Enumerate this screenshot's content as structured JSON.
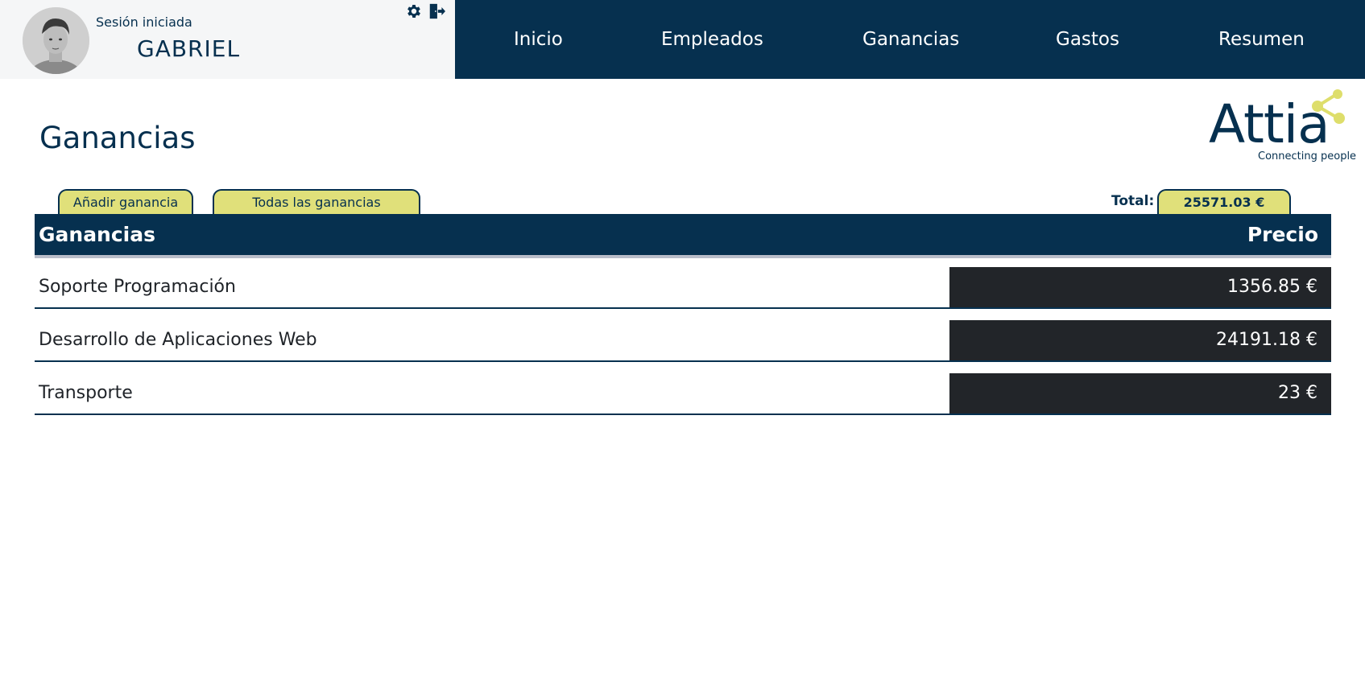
{
  "user": {
    "session_label": "Sesión iniciada",
    "name": "GABRIEL"
  },
  "icons": {
    "settings": "gear-icon",
    "logout": "logout-icon",
    "avatar": "user-photo"
  },
  "nav": {
    "items": [
      "Inicio",
      "Empleados",
      "Ganancias",
      "Gastos",
      "Resumen"
    ]
  },
  "page": {
    "title": "Ganancias"
  },
  "logo": {
    "word": "Attia",
    "tagline": "Connecting people"
  },
  "tabs": {
    "add": "Añadir ganancia",
    "all": "Todas las ganancias"
  },
  "total": {
    "label": "Total:",
    "value": "25571.03 €"
  },
  "table": {
    "headers": {
      "name": "Ganancias",
      "price": "Precio"
    },
    "rows": [
      {
        "name": "Soporte Programación",
        "price": "1356.85 €"
      },
      {
        "name": "Desarrollo de Aplicaciones Web",
        "price": "24191.18 €"
      },
      {
        "name": "Transporte",
        "price": "23 €"
      }
    ]
  },
  "colors": {
    "primary": "#06304f",
    "accent": "#e0e07a",
    "price_bg": "#222529",
    "panel_bg": "#f5f6f7"
  }
}
